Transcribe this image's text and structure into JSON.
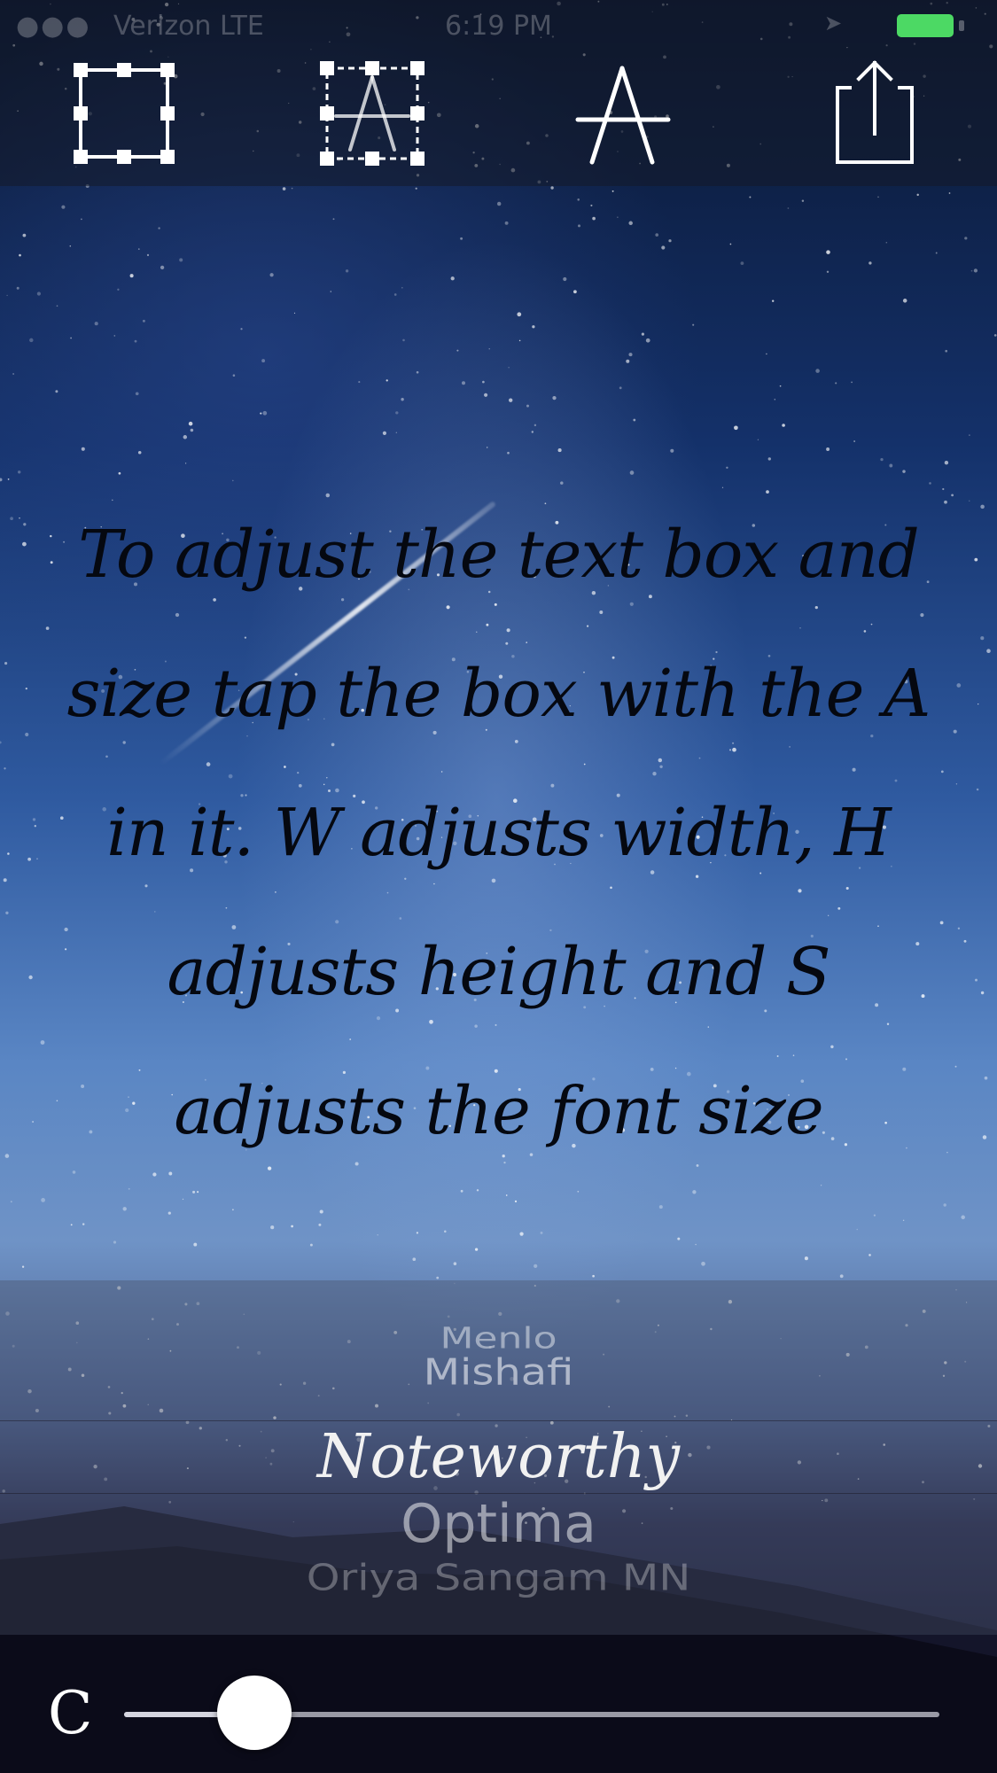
{
  "status_bar": {
    "signal": "●●●",
    "carrier": "Verizon  LTE",
    "time": "6:19 PM"
  },
  "toolbar": {
    "tools": [
      {
        "icon": "selection-box-icon"
      },
      {
        "icon": "text-box-adjust-icon"
      },
      {
        "icon": "font-letter-icon"
      },
      {
        "icon": "share-icon"
      }
    ]
  },
  "main_text": "To adjust the text box and size tap the box with the A in it. W adjusts width, H adjusts height and S adjusts the font size",
  "font_picker": {
    "options": [
      "Menlo",
      "Mishafi",
      "Noteworthy",
      "Optima",
      "Oriya Sangam MN"
    ],
    "selected": "Noteworthy"
  },
  "slider": {
    "label": "C",
    "value": 0.16
  },
  "colors": {
    "battery": "#4cd964",
    "text": "#050810"
  }
}
